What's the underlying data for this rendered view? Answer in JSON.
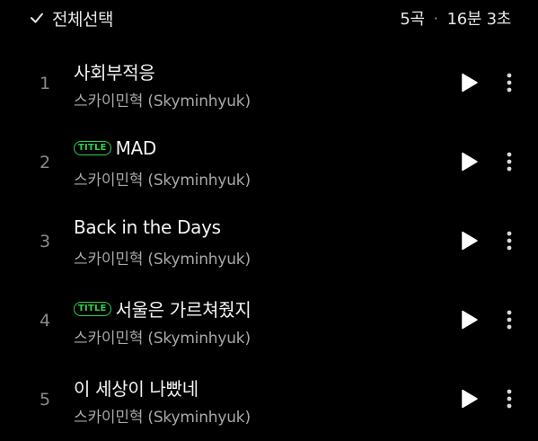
{
  "header": {
    "select_all_label": "전체선택",
    "track_count": "5곡",
    "total_duration": "16분 3초",
    "separator": "·"
  },
  "tracks": [
    {
      "number": "1",
      "title": "사회부적응",
      "is_title_track": false,
      "artist": "스카이민혁 (Skyminhyuk)"
    },
    {
      "number": "2",
      "title": "MAD",
      "is_title_track": true,
      "badge": "TITLE",
      "artist": "스카이민혁 (Skyminhyuk)"
    },
    {
      "number": "3",
      "title": "Back in the Days",
      "is_title_track": false,
      "artist": "스카이민혁 (Skyminhyuk)"
    },
    {
      "number": "4",
      "title": "서울은 가르쳐줬지",
      "is_title_track": true,
      "badge": "TITLE",
      "artist": "스카이민혁 (Skyminhyuk)"
    },
    {
      "number": "5",
      "title": "이 세상이 나빴네",
      "is_title_track": false,
      "artist": "스카이민혁 (Skyminhyuk)"
    }
  ],
  "colors": {
    "background": "#000000",
    "title_badge": "#2fd14a",
    "primary_text": "#f4f4f4",
    "secondary_text": "#a8a8a8"
  },
  "icons": {
    "select_all": "check-icon",
    "play": "play-icon",
    "more": "more-vertical-icon"
  }
}
